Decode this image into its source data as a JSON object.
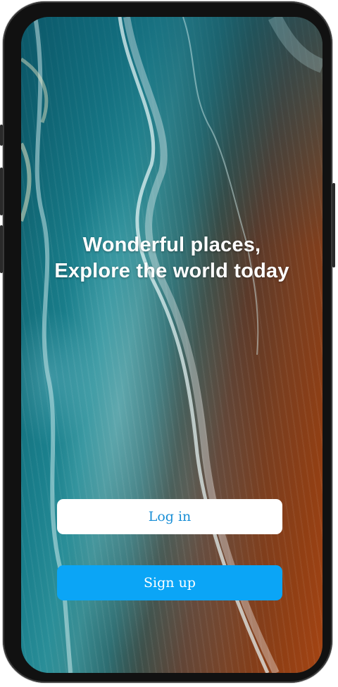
{
  "headline": {
    "line1": "Wonderful places,",
    "line2": "Explore the world today"
  },
  "buttons": {
    "login_label": "Log in",
    "signup_label": "Sign up"
  },
  "colors": {
    "primary": "#0ba5f6",
    "login_text": "#1a8fd6",
    "login_bg": "#ffffff"
  },
  "background": {
    "icon": "beach-aerial-photo"
  }
}
